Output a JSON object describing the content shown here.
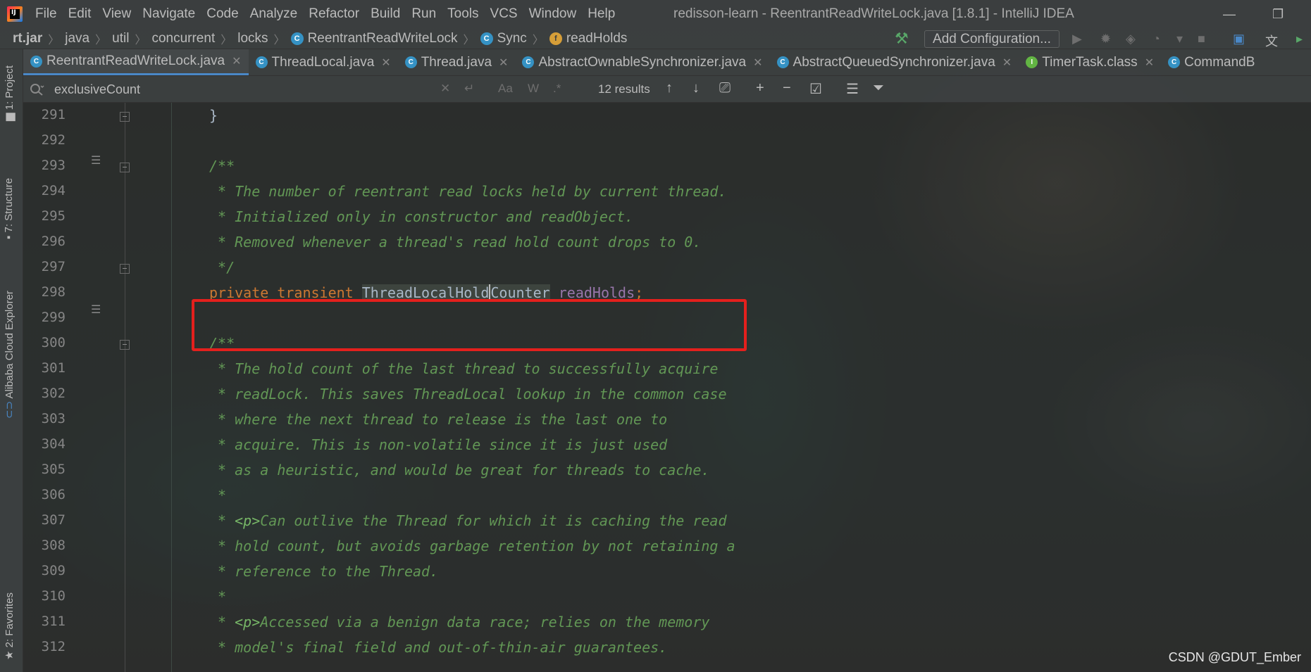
{
  "window": {
    "title": "redisson-learn - ReentrantReadWriteLock.java [1.8.1] - IntelliJ IDEA",
    "logo_text": "IJ"
  },
  "menu": [
    "File",
    "Edit",
    "View",
    "Navigate",
    "Code",
    "Analyze",
    "Refactor",
    "Build",
    "Run",
    "Tools",
    "VCS",
    "Window",
    "Help"
  ],
  "breadcrumb": {
    "items": [
      "rt.jar",
      "java",
      "util",
      "concurrent",
      "locks",
      "ReentrantReadWriteLock",
      "Sync",
      "readHolds"
    ]
  },
  "toolbar": {
    "add_configuration_label": "Add Configuration..."
  },
  "side_tabs": {
    "project": "1: Project",
    "structure": "7: Structure",
    "alibaba": "Alibaba Cloud Explorer",
    "favorites": "2: Favorites"
  },
  "tabs": [
    {
      "label": "ReentrantReadWriteLock.java",
      "icon": "C"
    },
    {
      "label": "ThreadLocal.java",
      "icon": "C"
    },
    {
      "label": "Thread.java",
      "icon": "C"
    },
    {
      "label": "AbstractOwnableSynchronizer.java",
      "icon": "C"
    },
    {
      "label": "AbstractQueuedSynchronizer.java",
      "icon": "C"
    },
    {
      "label": "TimerTask.class",
      "icon": "I"
    },
    {
      "label": "CommandB",
      "icon": "C"
    }
  ],
  "find": {
    "query": "exclusiveCount",
    "results": "12 results",
    "case_label": "Aa",
    "words_label": "W",
    "regex_label": ".*"
  },
  "editor": {
    "line_numbers": [
      "291",
      "292",
      "293",
      "294",
      "295",
      "296",
      "297",
      "298",
      "299",
      "300",
      "301",
      "302",
      "303",
      "304",
      "305",
      "306",
      "307",
      "308",
      "309",
      "310",
      "311",
      "312"
    ],
    "lines": {
      "l291": "}",
      "l293": "/**",
      "l294": " * The number of reentrant read locks held by current thread.",
      "l295": " * Initialized only in constructor and readObject.",
      "l296": " * Removed whenever a thread's read hold count drops to 0.",
      "l297": " */",
      "l298_kw1": "private",
      "l298_kw2": "transient",
      "l298_type_a": "ThreadLocalHold",
      "l298_type_b": "Counter",
      "l298_field": "readHolds",
      "l298_semi": ";",
      "l300": "/**",
      "l301": " * The hold count of the last thread to successfully acquire",
      "l302": " * readLock. This saves ThreadLocal lookup in the common case",
      "l303": " * where the next thread to release is the last one to",
      "l304": " * acquire. This is non-volatile since it is just used",
      "l305": " * as a heuristic, and would be great for threads to cache.",
      "l306": " *",
      "l307_pre": " * ",
      "l307_tag": "<p>",
      "l307_rest": "Can outlive the Thread for which it is caching the read",
      "l308": " * hold count, but avoids garbage retention by not retaining a",
      "l309": " * reference to the Thread.",
      "l310": " *",
      "l311_pre": " * ",
      "l311_tag": "<p>",
      "l311_rest": "Accessed via a benign data race; relies on the memory",
      "l312": " * model's final field and out-of-thin-air guarantees."
    }
  },
  "watermark": "CSDN @GDUT_Ember",
  "colors": {
    "keyword": "#cc7832",
    "comment": "#629755",
    "field": "#9876aa",
    "highlight_box": "#e4201d",
    "active_tab_underline": "#4a88c7"
  }
}
